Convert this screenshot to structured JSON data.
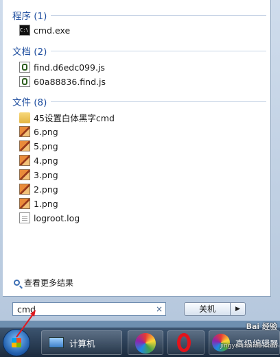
{
  "categories": [
    {
      "label": "程序 (1)",
      "items": [
        {
          "name": "cmd.exe",
          "icon": "cmd-icon"
        }
      ]
    },
    {
      "label": "文档 (2)",
      "items": [
        {
          "name": "find.d6edc099.js",
          "icon": "js-file-icon"
        },
        {
          "name": "60a88836.find.js",
          "icon": "js-file-icon"
        }
      ]
    },
    {
      "label": "文件 (8)",
      "items": [
        {
          "name": "45设置白体黑字cmd",
          "icon": "folder-icon"
        },
        {
          "name": "6.png",
          "icon": "image-file-icon"
        },
        {
          "name": "5.png",
          "icon": "image-file-icon"
        },
        {
          "name": "4.png",
          "icon": "image-file-icon"
        },
        {
          "name": "3.png",
          "icon": "image-file-icon"
        },
        {
          "name": "2.png",
          "icon": "image-file-icon"
        },
        {
          "name": "1.png",
          "icon": "image-file-icon"
        },
        {
          "name": "logroot.log",
          "icon": "log-file-icon"
        }
      ]
    }
  ],
  "see_more": "查看更多结果",
  "search": {
    "value": "cmd",
    "clear": "×"
  },
  "shutdown": {
    "label": "关机",
    "arrow": "▶"
  },
  "cmd_icon_text": "C:\\",
  "taskbar": {
    "computer_label": "计算机",
    "editor_label": "高级编辑器。"
  },
  "watermark": {
    "line1": "Bai 经验",
    "line2": "jingyan.baidu.com"
  },
  "colors": {
    "category": "#1e4d9e",
    "accent_arrow": "#e0191f"
  }
}
